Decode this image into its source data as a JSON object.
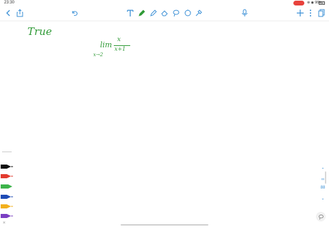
{
  "status_bar": {
    "time": "23:30",
    "icons": "⊛ ◉ 98%"
  },
  "toolbar": {
    "icons": [
      "chevron-left-icon",
      "share-icon",
      "undo-icon",
      "text-tool-icon",
      "pen-icon",
      "highlighter-icon",
      "eraser-icon",
      "lasso-icon",
      "shapes-icon",
      "magic-icon",
      "microphone-icon",
      "add-icon",
      "more-icon",
      "pages-icon"
    ]
  },
  "canvas": {
    "handwriting_1": "True",
    "handwriting_2": "lim",
    "handwriting_3": "x→2",
    "handwriting_4": "x",
    "handwriting_5": "x+1",
    "ink_color": "#2f9a36"
  },
  "palette": {
    "pens": [
      {
        "color": "#111111"
      },
      {
        "color": "#e23b2f"
      },
      {
        "color": "#3db34a"
      },
      {
        "color": "#1f4bb5"
      },
      {
        "color": "#f2b01e"
      },
      {
        "color": "#7b3fc2"
      }
    ]
  },
  "right_tools": {
    "up": "⌃",
    "zoom_label": "∞",
    "page_label": "88",
    "down": "⌄"
  },
  "corner": {
    "x_mark": "×"
  }
}
